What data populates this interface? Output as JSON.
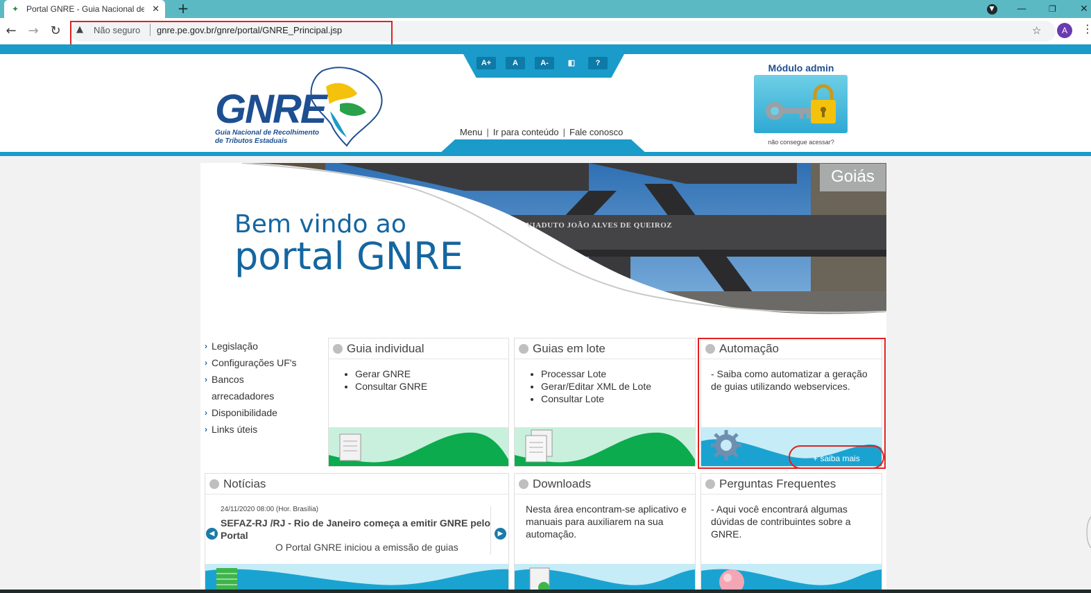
{
  "browser": {
    "tab_title": "Portal GNRE - Guia Nacional de Recolhimento",
    "tab_close": "✕",
    "new_tab": "+",
    "security_label": "Não seguro",
    "url": "gnre.pe.gov.br/gnre/portal/GNRE_Principal.jsp",
    "profile_initial": "A"
  },
  "accessibility": {
    "increase": "A+",
    "normal": "A",
    "decrease": "A-",
    "contrast": "◧",
    "help": "?"
  },
  "topnav": {
    "menu": "Menu",
    "content": "Ir para conteúdo",
    "contact": "Fale conosco",
    "separator": "|"
  },
  "logo": {
    "text": "GNRE",
    "subtitle_line1": "Guia Nacional de Recolhimento",
    "subtitle_line2": "de Tributos Estaduais"
  },
  "admin": {
    "title": "Módulo admin",
    "help": "não consegue acessar?"
  },
  "banner": {
    "line1": "Bem vindo ao",
    "line2": "portal GNRE",
    "state": "Goiás",
    "sign": "VIADUTO JOÃO ALVES DE QUEIROZ"
  },
  "sidebar": {
    "items": [
      {
        "label": "Legislação"
      },
      {
        "label": "Configurações UF's"
      },
      {
        "label": "Bancos"
      },
      {
        "label": "arrecadadores"
      },
      {
        "label": "Disponibilidade"
      },
      {
        "label": "Links úteis"
      }
    ]
  },
  "cards": {
    "individual": {
      "title": "Guia individual",
      "items": [
        "Gerar GNRE",
        "Consultar GNRE"
      ]
    },
    "lote": {
      "title": "Guias em lote",
      "items": [
        "Processar Lote",
        "Gerar/Editar XML de Lote",
        "Consultar Lote"
      ]
    },
    "automacao": {
      "title": "Automação",
      "text": "- Saiba como automatizar a geração de guias utilizando webservices.",
      "more": "+ saiba mais"
    },
    "noticias": {
      "title": "Notícias",
      "date": "24/11/2020 08:00 (Hor. Brasília)",
      "headline": "SEFAZ-RJ /RJ - Rio de Janeiro começa a emitir GNRE pelo Portal",
      "summary": "O Portal GNRE iniciou a emissão de guias"
    },
    "downloads": {
      "title": "Downloads",
      "text": "Nesta área encontram-se aplicativo e manuais para auxiliarem na sua automação."
    },
    "faq": {
      "title": "Perguntas Frequentes",
      "text": "- Aqui você encontrará algumas dúvidas de contribuintes sobre a GNRE."
    }
  },
  "colors": {
    "brand_blue": "#1466a0",
    "header_cyan": "#1a9bc9",
    "green_wave": "#0cab4e",
    "highlight_red": "#e02020"
  }
}
